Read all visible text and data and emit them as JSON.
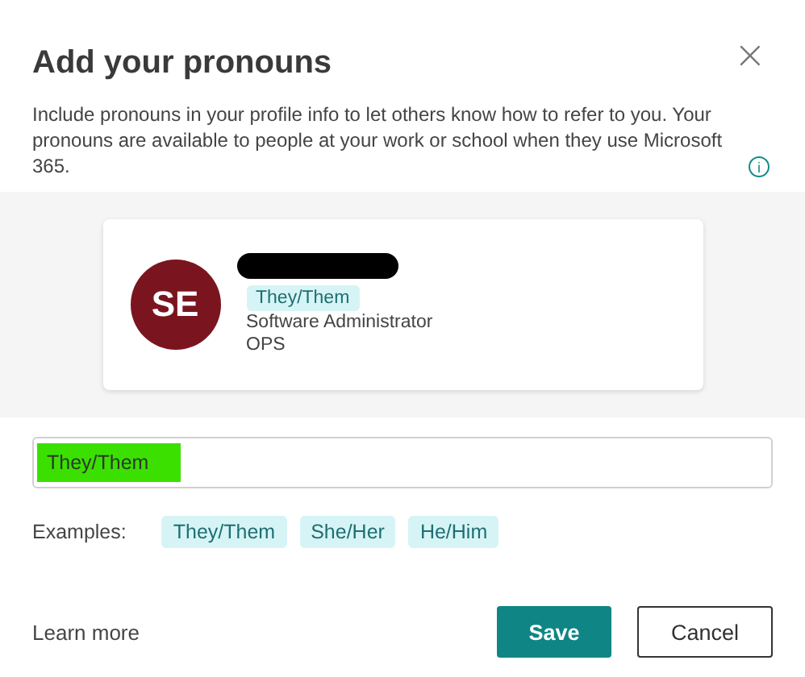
{
  "dialog": {
    "title": "Add your pronouns",
    "close": "×",
    "description": "Include pronouns in your profile info to let others know how to refer to you. Your pronouns are available to people at your work or school when they use Microsoft 365.",
    "info_icon": "i"
  },
  "profile_card": {
    "initials": "SE",
    "name_redacted": true,
    "pronouns": "They/Them",
    "job_title": "Software Administrator",
    "department": "OPS"
  },
  "pronouns_field": {
    "value": "They/Them",
    "highlighted": true
  },
  "examples": {
    "label": "Examples:",
    "items": [
      "They/Them",
      "She/Her",
      "He/Him"
    ]
  },
  "footer": {
    "link": "Learn more",
    "buttons": [
      {
        "label": "Save",
        "kind": "primary"
      },
      {
        "label": "Cancel",
        "kind": "secondary"
      }
    ]
  }
}
